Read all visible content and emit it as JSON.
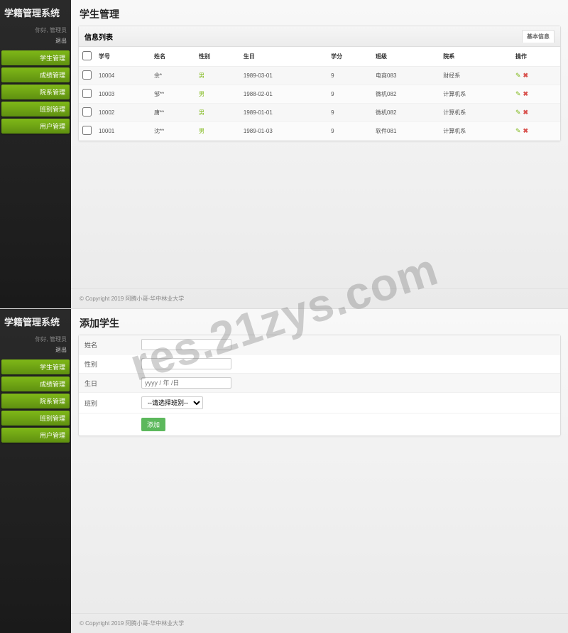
{
  "app_title": "学籍管理系统",
  "greeting": "你好, 管理员",
  "logout_label": "退出",
  "nav": [
    "学生管理",
    "成绩管理",
    "院系管理",
    "班别管理",
    "用户管理"
  ],
  "page1": {
    "title": "学生管理",
    "panel_title": "信息列表",
    "tab_label": "基本信息",
    "columns": [
      "",
      "学号",
      "姓名",
      "性别",
      "生日",
      "学分",
      "班级",
      "院系",
      "操作"
    ],
    "rows": [
      {
        "id": "10004",
        "name": "余*",
        "gender": "男",
        "birth": "1989-03-01",
        "credit": "9",
        "class": "电商083",
        "dept": "财经系"
      },
      {
        "id": "10003",
        "name": "邹**",
        "gender": "男",
        "birth": "1988-02-01",
        "credit": "9",
        "class": "微机082",
        "dept": "计算机系"
      },
      {
        "id": "10002",
        "name": "唐**",
        "gender": "男",
        "birth": "1989-01-01",
        "credit": "9",
        "class": "微机082",
        "dept": "计算机系"
      },
      {
        "id": "10001",
        "name": "沈**",
        "gender": "男",
        "birth": "1989-01-03",
        "credit": "9",
        "class": "软件081",
        "dept": "计算机系"
      }
    ]
  },
  "page2": {
    "title": "添加学生",
    "labels": {
      "name": "姓名",
      "gender": "性别",
      "birth": "生日",
      "class": "班别"
    },
    "birth_placeholder": "yyyy / 年 /日",
    "class_placeholder": "--请选择班别--",
    "submit_label": "添加"
  },
  "footer": "© Copyright 2019 阿腾小哥-华中林业大学",
  "watermark": "res.21zys.com"
}
